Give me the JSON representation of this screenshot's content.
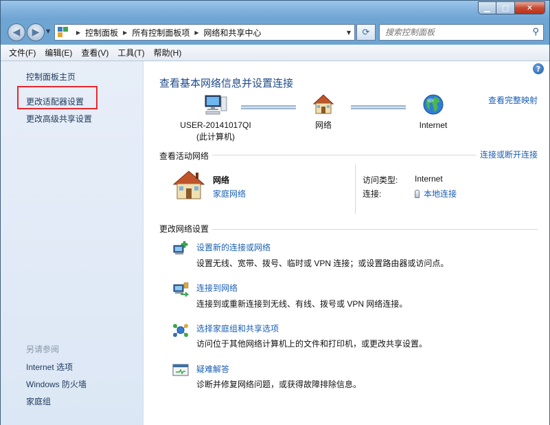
{
  "window": {
    "title": "",
    "controls": {
      "minimize": "▁",
      "maximize": "□",
      "close": "✕"
    }
  },
  "nav": {
    "back": "◀",
    "forward": "▶",
    "breadcrumbs": [
      "控制面板",
      "所有控制面板项",
      "网络和共享中心"
    ],
    "search_placeholder": "搜索控制面板"
  },
  "menu": [
    "文件(F)",
    "编辑(E)",
    "查看(V)",
    "工具(T)",
    "帮助(H)"
  ],
  "sidebar": {
    "links": [
      "控制面板主页",
      "更改适配器设置",
      "更改高级共享设置"
    ],
    "see_also_heading": "另请参阅",
    "see_also": [
      "Internet 选项",
      "Windows 防火墙",
      "家庭组"
    ]
  },
  "main": {
    "title": "查看基本网络信息并设置连接",
    "full_map_link": "查看完整映射",
    "map": {
      "computer_name": "USER-20141017QI",
      "computer_sub": "(此计算机)",
      "network": "网络",
      "internet": "Internet"
    },
    "active_section": {
      "title": "查看活动网络",
      "connect_link": "连接或断开连接",
      "network_name": "网络",
      "network_type": "家庭网络",
      "access_type_label": "访问类型:",
      "access_type_value": "Internet",
      "connection_label": "连接:",
      "connection_value": "本地连接"
    },
    "change_section": {
      "title": "更改网络设置",
      "tasks": [
        {
          "link": "设置新的连接或网络",
          "desc": "设置无线、宽带、拨号、临时或 VPN 连接；或设置路由器或访问点。"
        },
        {
          "link": "连接到网络",
          "desc": "连接到或重新连接到无线、有线、拨号或 VPN 网络连接。"
        },
        {
          "link": "选择家庭组和共享选项",
          "desc": "访问位于其他网络计算机上的文件和打印机，或更改共享设置。"
        },
        {
          "link": "疑难解答",
          "desc": "诊断并修复网络问题，或获得故障排除信息。"
        }
      ]
    }
  },
  "colors": {
    "accent": "#1a5fb4",
    "highlight": "#e8272b",
    "title_blue": "#1e4a8a"
  }
}
